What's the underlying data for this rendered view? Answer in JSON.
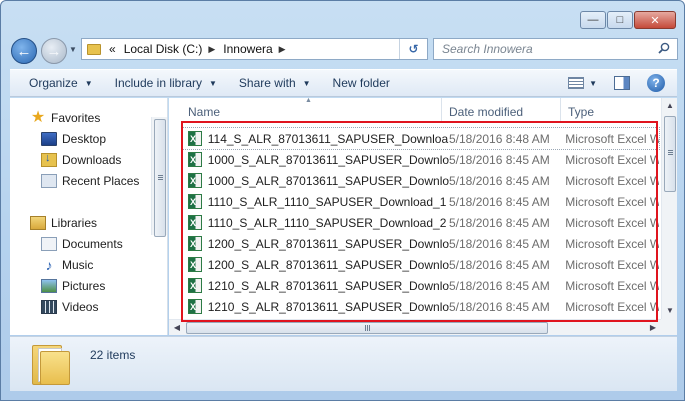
{
  "window": {
    "minimize_glyph": "—",
    "maximize_glyph": "□",
    "close_glyph": "✕"
  },
  "nav": {
    "back_glyph": "←",
    "forward_glyph": "→",
    "overflow": "«",
    "breadcrumb": [
      "Local Disk (C:)",
      "Innowera"
    ],
    "refresh_glyph": "↺",
    "search_placeholder": "Search Innowera"
  },
  "toolbar": {
    "organize": "Organize",
    "include_in_library": "Include in library",
    "share_with": "Share with",
    "new_folder": "New folder",
    "help_glyph": "?"
  },
  "sidebar": {
    "favorites": "Favorites",
    "desktop": "Desktop",
    "downloads": "Downloads",
    "recent_places": "Recent Places",
    "libraries": "Libraries",
    "documents": "Documents",
    "music": "Music",
    "pictures": "Pictures",
    "videos": "Videos"
  },
  "columns": {
    "name": "Name",
    "date_modified": "Date modified",
    "type": "Type"
  },
  "files": [
    {
      "name": "114_S_ALR_87013611_SAPUSER_Downloa...",
      "date": "5/18/2016 8:48 AM",
      "type": "Microsoft Excel W"
    },
    {
      "name": "1000_S_ALR_87013611_SAPUSER_Downlo...",
      "date": "5/18/2016 8:45 AM",
      "type": "Microsoft Excel W"
    },
    {
      "name": "1000_S_ALR_87013611_SAPUSER_Downlo...",
      "date": "5/18/2016 8:45 AM",
      "type": "Microsoft Excel W"
    },
    {
      "name": "1110_S_ALR_1110_SAPUSER_Download_1 ...",
      "date": "5/18/2016 8:45 AM",
      "type": "Microsoft Excel W"
    },
    {
      "name": "1110_S_ALR_1110_SAPUSER_Download_2 ...",
      "date": "5/18/2016 8:45 AM",
      "type": "Microsoft Excel W"
    },
    {
      "name": "1200_S_ALR_87013611_SAPUSER_Downlo...",
      "date": "5/18/2016 8:45 AM",
      "type": "Microsoft Excel W"
    },
    {
      "name": "1200_S_ALR_87013611_SAPUSER_Downlo...",
      "date": "5/18/2016 8:45 AM",
      "type": "Microsoft Excel W"
    },
    {
      "name": "1210_S_ALR_87013611_SAPUSER_Downlo...",
      "date": "5/18/2016 8:45 AM",
      "type": "Microsoft Excel W"
    },
    {
      "name": "1210_S_ALR_87013611_SAPUSER_Downlo...",
      "date": "5/18/2016 8:45 AM",
      "type": "Microsoft Excel W"
    }
  ],
  "details": {
    "item_count": "22 items"
  },
  "colors": {
    "highlight_border": "#e0141e",
    "excel_green": "#1e7145"
  }
}
